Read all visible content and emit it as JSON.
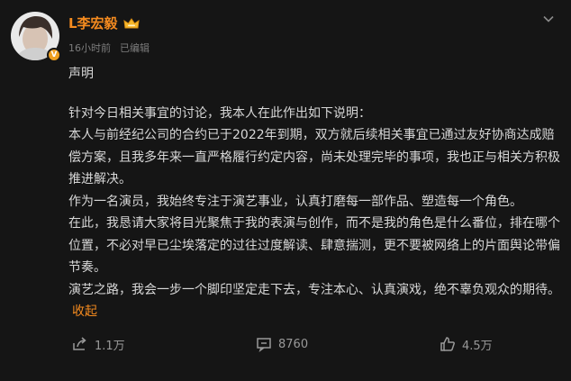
{
  "author": {
    "name": "L李宏毅",
    "verified_badge": "V",
    "crown_icon": "crown-icon",
    "name_color": "#f58b1f"
  },
  "meta": {
    "time": "16小时前",
    "edited": "已编辑"
  },
  "post": {
    "title": "声明",
    "paragraphs": [
      "针对今日相关事宜的讨论，我本人在此作出如下说明：",
      "本人与前经纪公司的合约已于2022年到期，双方就后续相关事宜已通过友好协商达成赔偿方案，且我多年来一直严格履行约定内容，尚未处理完毕的事项，我也正与相关方积极推进解决。",
      "作为一名演员，我始终专注于演艺事业，认真打磨每一部作品、塑造每一个角色。",
      "在此，我恳请大家将目光聚焦于我的表演与创作，而不是我的角色是什么番位，排在哪个位置，不必对早已尘埃落定的过往过度解读、肆意揣测，更不要被网络上的片面舆论带偏节奏。",
      "演艺之路，我会一步一个脚印坚定走下去，专注本心、认真演戏，绝不辜负观众的期待。"
    ],
    "collapse_label": "收起"
  },
  "actions": {
    "share_count": "1.1万",
    "comment_count": "8760",
    "like_count": "4.5万"
  },
  "colors": {
    "background": "#151515",
    "accent": "#f58b1f",
    "text": "#d8d8d8",
    "muted": "#7d7d7d"
  }
}
